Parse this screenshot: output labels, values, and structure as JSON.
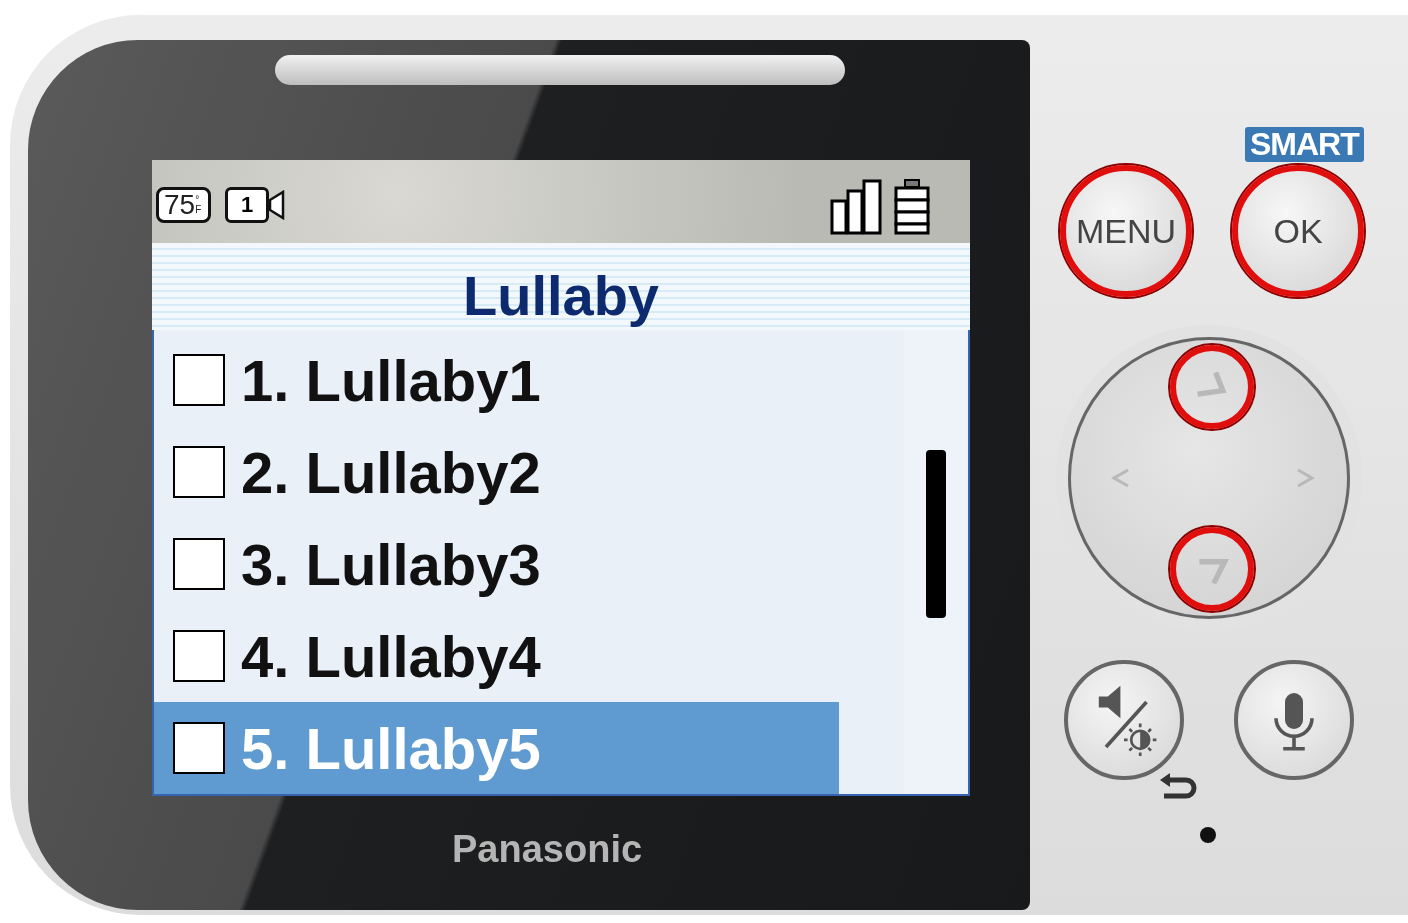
{
  "device": {
    "brand": "Panasonic",
    "smart_label": "SMART",
    "buttons": [
      {
        "kind": "menu",
        "label": "MENU",
        "highlighted": true
      },
      {
        "kind": "ok",
        "label": "OK",
        "highlighted": true
      }
    ],
    "dpad": {
      "up_highlighted": true,
      "down_highlighted": true
    }
  },
  "screen": {
    "status": {
      "temperature": "75",
      "unit": "°F",
      "camera": "1"
    },
    "title": "Lullaby",
    "items": [
      {
        "label": "1. Lullaby1",
        "checked": false,
        "selected": false
      },
      {
        "label": "2. Lullaby2",
        "checked": false,
        "selected": false
      },
      {
        "label": "3. Lullaby3",
        "checked": false,
        "selected": false
      },
      {
        "label": "4. Lullaby4",
        "checked": false,
        "selected": false
      },
      {
        "label": "5. Lullaby5",
        "checked": false,
        "selected": true
      }
    ]
  }
}
